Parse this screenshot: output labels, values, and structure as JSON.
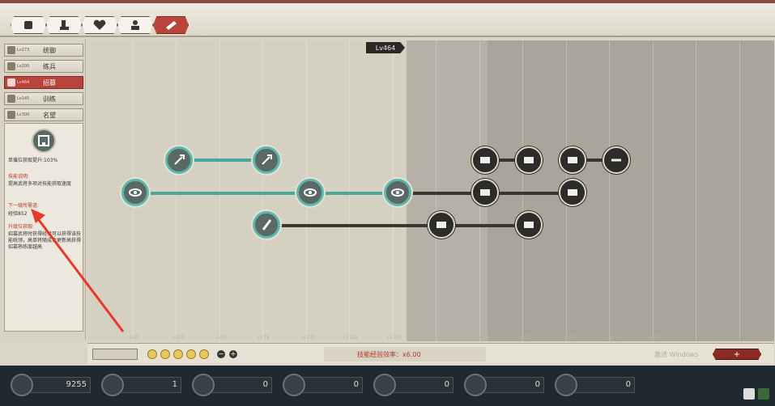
{
  "topbar": {
    "tabs": [
      {
        "icon": "fist-icon",
        "active": false
      },
      {
        "icon": "boot-icon",
        "active": false
      },
      {
        "icon": "heart-icon",
        "active": false
      },
      {
        "icon": "person-icon",
        "active": false
      },
      {
        "icon": "scroll-icon",
        "active": true
      }
    ]
  },
  "sidebar": {
    "items": [
      {
        "label": "统御",
        "level": "Lv273",
        "active": false
      },
      {
        "label": "练兵",
        "level": "Lv200",
        "active": false
      },
      {
        "label": "招募",
        "level": "Lv464",
        "active": true
      },
      {
        "label": "训练",
        "level": "Lv145",
        "active": false
      },
      {
        "label": "名望",
        "level": "Lv300",
        "active": false
      }
    ]
  },
  "info": {
    "current_effect": "单循位获取提升:103%",
    "desc_title": "技能说明:",
    "desc_text": "提高武将多项对技能获取速度",
    "next_title": "下一级所需道:",
    "next_value": "经验852",
    "hint_title": "升级位获取:",
    "hint_text": "招募武将时获得经验可以获得该技能统领，高单将随成合更新高获得招募熟练度越高"
  },
  "tree": {
    "current_level": "Lv464",
    "axis_labels": [
      "Lv0",
      "Lv25",
      "Lv50",
      "Lv75",
      "Lv100",
      "Lv125",
      "Lv150",
      "Lv175",
      "Lv200",
      "Lv225",
      "Lv250",
      "Lv275",
      "Lv300"
    ]
  },
  "bottom": {
    "exp_rate": "技能经验效率：x6.00",
    "add_label": "+",
    "watermark": "激活 Windows"
  },
  "resources": [
    {
      "icon": "horse-icon",
      "value": "9255"
    },
    {
      "icon": "flag-icon",
      "value": "1"
    },
    {
      "icon": "coin-icon",
      "value": "0"
    },
    {
      "icon": "scatter-icon",
      "value": "0"
    },
    {
      "icon": "swirl-icon",
      "value": "0"
    },
    {
      "icon": "swirl2-icon",
      "value": "0"
    },
    {
      "icon": "cannon-icon",
      "value": "0"
    }
  ]
}
